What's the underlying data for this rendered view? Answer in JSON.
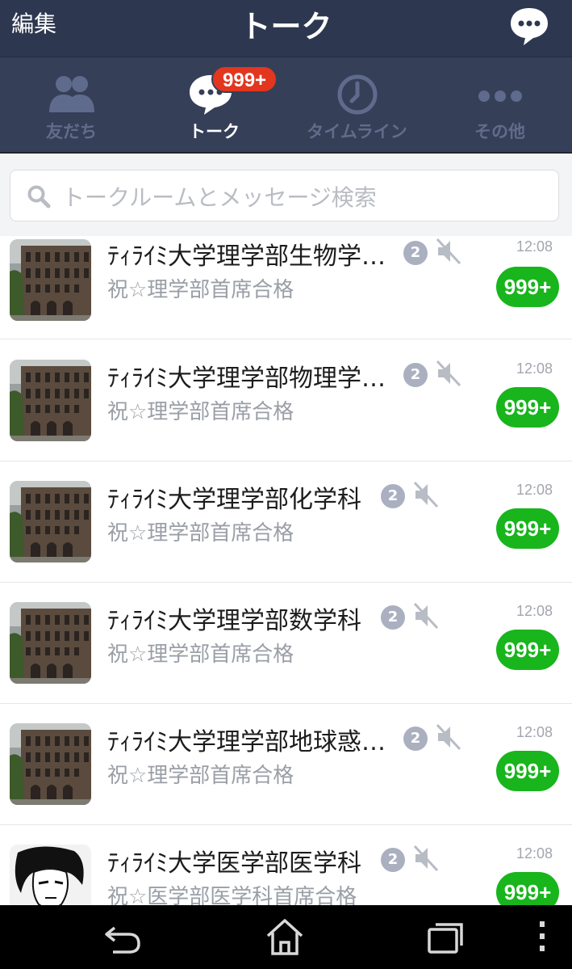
{
  "header": {
    "edit_label": "編集",
    "title": "トーク",
    "chat_icon": "chat-bubble-icon"
  },
  "tabs": [
    {
      "label": "友だち",
      "icon": "friends-icon",
      "active": false
    },
    {
      "label": "トーク",
      "icon": "talk-bubble-icon",
      "active": true,
      "badge": "999+"
    },
    {
      "label": "タイムライン",
      "icon": "clock-icon",
      "active": false
    },
    {
      "label": "その他",
      "icon": "more-dots-icon",
      "active": false
    }
  ],
  "search": {
    "placeholder": "トークルームとメッセージ検索"
  },
  "chats": [
    {
      "name": "ﾃｨﾗｲﾐ大学理学部生物学…",
      "count": "2",
      "message": "祝☆理学部首席合格",
      "time": "12:08",
      "unread": "999+",
      "avatar": "building"
    },
    {
      "name": "ﾃｨﾗｲﾐ大学理学部物理学…",
      "count": "2",
      "message": "祝☆理学部首席合格",
      "time": "12:08",
      "unread": "999+",
      "avatar": "building"
    },
    {
      "name": "ﾃｨﾗｲﾐ大学理学部化学科",
      "count": "2",
      "message": "祝☆理学部首席合格",
      "time": "12:08",
      "unread": "999+",
      "avatar": "building"
    },
    {
      "name": "ﾃｨﾗｲﾐ大学理学部数学科",
      "count": "2",
      "message": "祝☆理学部首席合格",
      "time": "12:08",
      "unread": "999+",
      "avatar": "building"
    },
    {
      "name": "ﾃｨﾗｲﾐ大学理学部地球惑…",
      "count": "2",
      "message": "祝☆理学部首席合格",
      "time": "12:08",
      "unread": "999+",
      "avatar": "building"
    },
    {
      "name": "ﾃｨﾗｲﾐ大学医学部医学科",
      "count": "2",
      "message": "祝☆医学部医学科首席合格",
      "time": "12:08",
      "unread": "999+",
      "avatar": "character"
    }
  ],
  "navbar": {
    "back_icon": "back-icon",
    "home_icon": "home-icon",
    "recent_icon": "recent-apps-icon",
    "menu_icon": "overflow-menu-icon"
  },
  "colors": {
    "header_bg": "#2e3750",
    "tab_bg": "#363f58",
    "unread_green": "#18b51c",
    "badge_red": "#e3361f"
  }
}
